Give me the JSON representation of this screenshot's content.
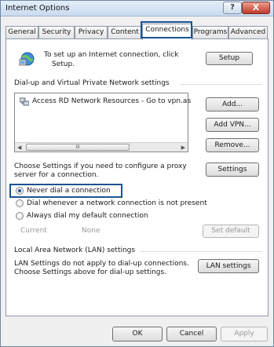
{
  "window": {
    "title": "Internet Options"
  },
  "titlebar": {
    "help_label": "?",
    "close_label": "X"
  },
  "tabs": [
    {
      "label": "General"
    },
    {
      "label": "Security"
    },
    {
      "label": "Privacy"
    },
    {
      "label": "Content"
    },
    {
      "label": "Connections"
    },
    {
      "label": "Programs"
    },
    {
      "label": "Advanced"
    }
  ],
  "active_tab": "Connections",
  "setup": {
    "text_line1": "To set up an Internet connection, click",
    "text_line2": "Setup.",
    "button": "Setup"
  },
  "dialup": {
    "heading": "Dial-up and Virtual Private Network settings",
    "list_items": [
      {
        "label": "Access RD Network Resources - Go to vpn.as"
      }
    ],
    "scroll_thumb_label": "III",
    "add_button": "Add...",
    "add_vpn_button": "Add VPN...",
    "remove_button": "Remove...",
    "settings_text_line1": "Choose Settings if you need to configure a proxy",
    "settings_text_line2": "server for a connection.",
    "settings_button": "Settings",
    "options": [
      {
        "label": "Never dial a connection",
        "selected": true
      },
      {
        "label": "Dial whenever a network connection is not present",
        "selected": false
      },
      {
        "label": "Always dial my default connection",
        "selected": false
      }
    ],
    "current_label": "Current",
    "current_value": "None",
    "set_default_button": "Set default"
  },
  "lan": {
    "heading": "Local Area Network (LAN) settings",
    "text_line1": "LAN Settings do not apply to dial-up connections.",
    "text_line2": "Choose Settings above for dial-up settings.",
    "button": "LAN settings"
  },
  "footer": {
    "ok": "OK",
    "cancel": "Cancel",
    "apply": "Apply"
  },
  "colors": {
    "highlight": "#1a5591",
    "window_border": "#6f86a0",
    "selected_radio": "#1f4f9b"
  },
  "icons": {
    "connection": "globe-network-icon",
    "vpn_item": "network-connection-icon"
  }
}
